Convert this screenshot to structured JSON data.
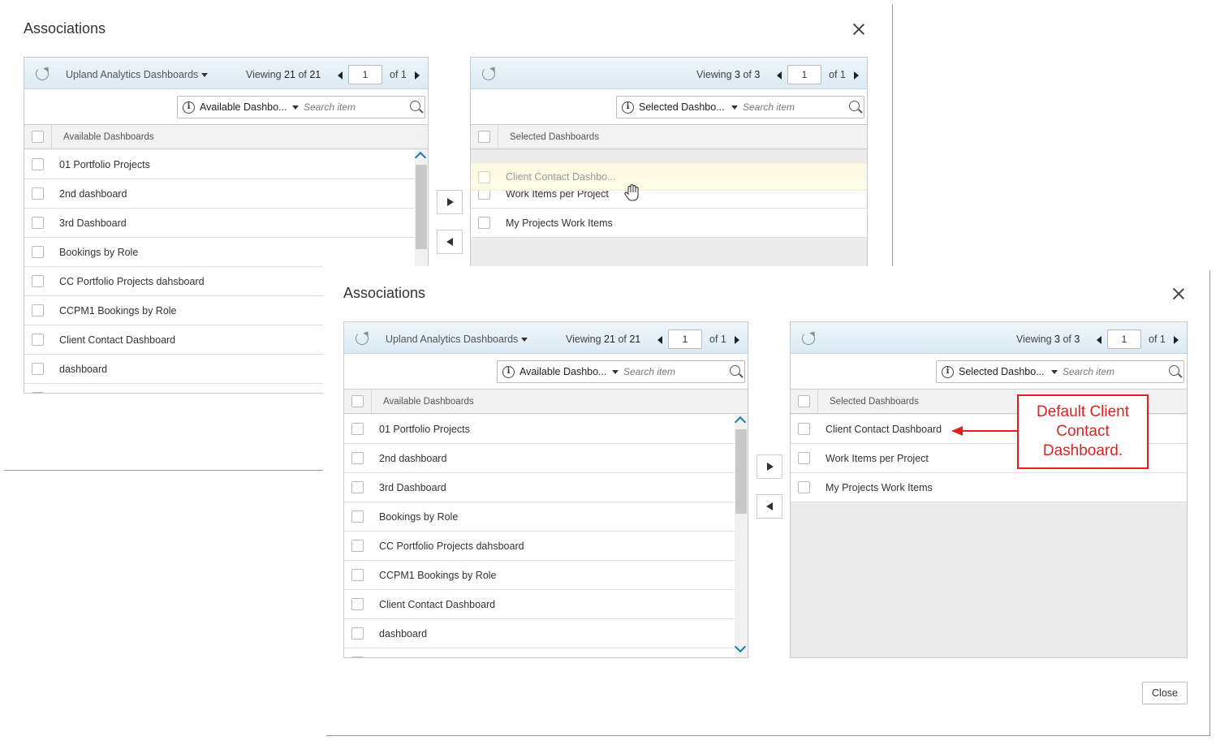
{
  "back_dialog": {
    "title": "Associations",
    "available": {
      "category": "Upland Analytics Dashboards",
      "viewing_prefix": "Viewing",
      "viewing_count": "21",
      "viewing_of": "of",
      "viewing_total": "21",
      "page": "1",
      "of_pages": "of 1",
      "filter_label": "Available Dashbo...",
      "search_placeholder": "Search item",
      "column_header": "Available Dashboards",
      "rows": [
        "01 Portfolio Projects",
        "2nd dashboard",
        "3rd Dashboard",
        "Bookings by Role",
        "CC Portfolio Projects dahsboard",
        "CCPM1 Bookings by Role",
        "Client Contact Dashboard",
        "dashboard"
      ]
    },
    "selected": {
      "viewing_prefix": "Viewing",
      "viewing_count": "3",
      "viewing_of": "of",
      "viewing_total": "3",
      "page": "1",
      "of_pages": "of 1",
      "filter_label": "Selected Dashbo...",
      "search_placeholder": "Search item",
      "column_header": "Selected Dashboards",
      "dragging_item": "Client Contact Dashbo...",
      "rows": [
        "Work Items per Project",
        "My Projects Work Items"
      ]
    }
  },
  "front_dialog": {
    "title": "Associations",
    "available": {
      "category": "Upland Analytics Dashboards",
      "viewing_prefix": "Viewing",
      "viewing_count": "21",
      "viewing_of": "of",
      "viewing_total": "21",
      "page": "1",
      "of_pages": "of 1",
      "filter_label": "Available Dashbo...",
      "search_placeholder": "Search item",
      "column_header": "Available Dashboards",
      "rows": [
        "01 Portfolio Projects",
        "2nd dashboard",
        "3rd Dashboard",
        "Bookings by Role",
        "CC Portfolio Projects dahsboard",
        "CCPM1 Bookings by Role",
        "Client Contact Dashboard",
        "dashboard"
      ]
    },
    "selected": {
      "viewing_prefix": "Viewing",
      "viewing_count": "3",
      "viewing_of": "of",
      "viewing_total": "3",
      "page": "1",
      "of_pages": "of 1",
      "filter_label": "Selected Dashbo...",
      "search_placeholder": "Search item",
      "column_header": "Selected Dashboards",
      "rows": [
        "Client Contact Dashboard",
        "Work Items per Project",
        "My Projects Work Items"
      ]
    },
    "close_label": "Close"
  },
  "annotation": {
    "callout_text": "Default Client Contact Dashboard.",
    "color": "#e02020"
  },
  "colors": {
    "header_gradient_top": "#eef6fb",
    "header_gradient_bottom": "#dbeaf4",
    "scroll_arrow": "#1a7fa8"
  }
}
